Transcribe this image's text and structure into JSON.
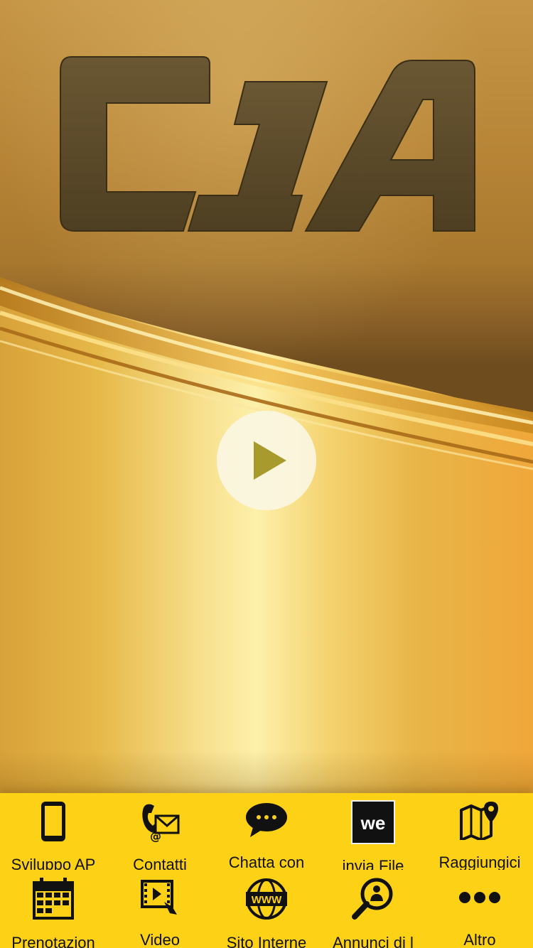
{
  "hero": {
    "logo_text": "C1A",
    "play_button_icon": "play-icon"
  },
  "nav": {
    "items": [
      {
        "label": "Sviluppo AP",
        "icon": "smartphone-icon"
      },
      {
        "label": "Contatti",
        "icon": "phone-mail-icon"
      },
      {
        "label": "Chatta con",
        "icon": "chat-bubble-icon"
      },
      {
        "label": "invia File",
        "icon": "wetransfer-icon",
        "icon_text": "we"
      },
      {
        "label": "Raggiungici",
        "icon": "map-pin-icon"
      },
      {
        "label": "Prenotazion",
        "icon": "calendar-icon"
      },
      {
        "label": "Video",
        "icon": "video-play-icon"
      },
      {
        "label": "Sito Interne",
        "icon": "www-globe-icon",
        "icon_text": "WWW"
      },
      {
        "label": "Annunci di l",
        "icon": "search-person-icon"
      },
      {
        "label": "Altro",
        "icon": "more-dots-icon"
      }
    ]
  },
  "colors": {
    "nav_background": "#fcd116",
    "logo_fill": "#5d4b2a",
    "play_triangle": "#a89a2c"
  }
}
